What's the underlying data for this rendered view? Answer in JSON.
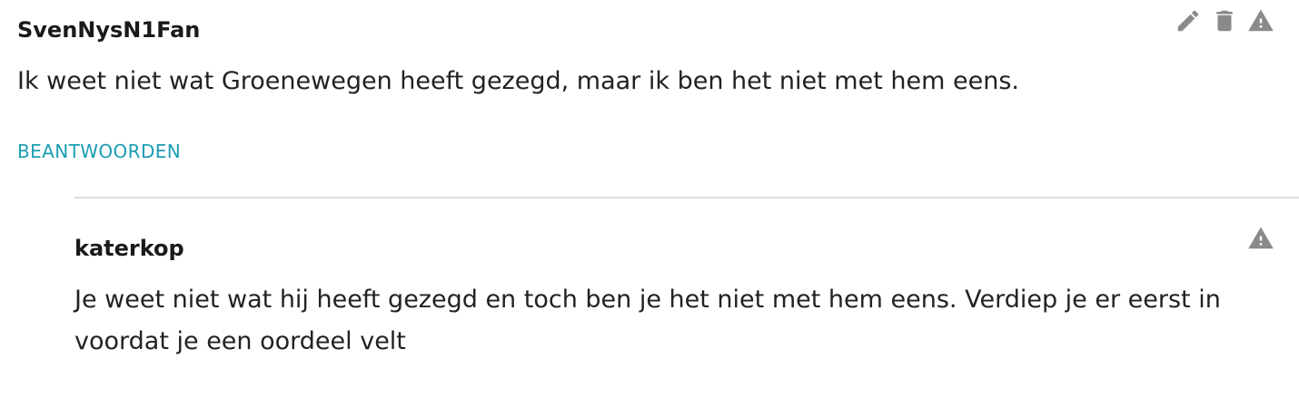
{
  "comments": [
    {
      "author": "SvenNysN1Fan",
      "text": "Ik weet niet wat Groenewegen heeft gezegd, maar ik ben het niet met hem eens.",
      "reply_label": "BEANTWOORDEN",
      "actions": [
        "pencil-icon",
        "trash-icon",
        "warning-icon"
      ]
    }
  ],
  "replies": [
    {
      "author": "katerkop",
      "text": "Je weet niet wat hij heeft gezegd en toch ben je het niet met hem eens. Verdiep je er eerst in voordat je een oordeel velt",
      "actions": [
        "warning-icon"
      ]
    }
  ],
  "colors": {
    "link": "#1b9db3",
    "icon": "#8a8a8a",
    "divider": "#dcdcdc",
    "text": "#222222"
  }
}
